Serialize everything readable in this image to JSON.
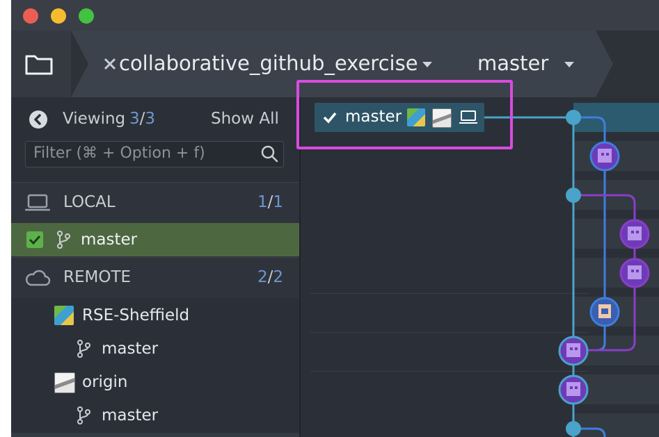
{
  "repo": {
    "name": "collaborative_github_exercise",
    "branch": "master"
  },
  "sidebar": {
    "viewing_label": "Viewing",
    "viewing_count": "3",
    "viewing_sep": "/",
    "viewing_total": "3",
    "show_all": "Show All",
    "filter_placeholder": "Filter (⌘ + Option + f)",
    "local": {
      "label": "LOCAL",
      "count": "1",
      "sep": "/",
      "total": "1",
      "branches": [
        {
          "name": "master",
          "checked": true
        }
      ]
    },
    "remote": {
      "label": "REMOTE",
      "count": "2",
      "sep": "/",
      "total": "2",
      "remotes": [
        {
          "name": "RSE-Sheffield",
          "icon": "lego-avatar",
          "branches": [
            "master"
          ]
        },
        {
          "name": "origin",
          "icon": "photo-avatar",
          "branches": [
            "master"
          ]
        }
      ]
    }
  },
  "graph": {
    "branch_tag": {
      "label": "master",
      "icons": [
        "check-icon",
        "lego-avatar",
        "photo-avatar",
        "laptop-icon"
      ]
    },
    "colors": {
      "lane_teal": "#4aa3c8",
      "lane_blue": "#3f7ee0",
      "lane_purple": "#8a3ec8",
      "commit_fill": "#6d3bb8",
      "highlight": "#d94be0"
    }
  }
}
